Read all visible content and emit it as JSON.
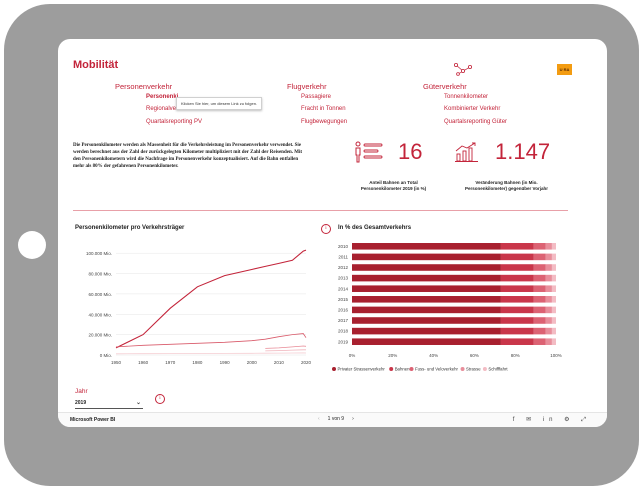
{
  "report": {
    "title": "Mobilität",
    "logo_text": "U RA",
    "nav_sections": [
      {
        "label": "Personenverkehr",
        "items": [
          "Personenki",
          "Regionalve...",
          "Quartalsreporting PV"
        ]
      },
      {
        "label": "Flugverkehr",
        "items": [
          "Passagiere",
          "Fracht in Tonnen",
          "Flugbewegungen"
        ]
      },
      {
        "label": "Güterverkehr",
        "items": [
          "Tonnenkilometer",
          "Kombinierter Verkehr",
          "Quartalsreporting Güter"
        ]
      }
    ],
    "tooltip": "Klicken Sie hier, um diesem Link zu folgen.",
    "description": "Die Personenkilometer werden als Massenheit für die Verkehrsleistung im Personenverkehr verwendet. Sie werden berechnet aus der Zahl der zurückgelegten Kilometer multipliziert mit der Zahl der Reisenden. Mit den Personenkilometern wird die Nachfrage im Personenverkehr konzeptualisiert. Auf die Bahn entfallen mehr als 80% der gefahrenen Personenkilometer.",
    "kpi": [
      {
        "value": "16",
        "label_lines": [
          "Anteil Bahnen an Total",
          "Personenkilometer 2019 (in %)"
        ],
        "icon": "people-bars-icon"
      },
      {
        "value": "1.147",
        "label_lines": [
          "Veränderung Bahnen (in Mio.",
          "Personenkilometer) gegenüber Vorjahr"
        ],
        "icon": "bar-growth-icon"
      }
    ],
    "slicer": {
      "label": "Jahr",
      "value": "2019"
    },
    "footer": {
      "brand": "Microsoft Power BI",
      "page": "1 von 9",
      "prev": "‹",
      "next": "›",
      "share_icons": "f ✉ in ⚙ ⤢"
    }
  },
  "chart_data": [
    {
      "type": "line",
      "title": "Personenkilometer pro Verkehrsträger",
      "x": [
        1950,
        1960,
        1970,
        1980,
        1990,
        2000,
        2005,
        2010,
        2015,
        2019,
        2020
      ],
      "ylim": [
        0,
        110000
      ],
      "yticks": [
        0,
        20000,
        40000,
        60000,
        80000,
        100000
      ],
      "ytick_labels": [
        "0 Mio.",
        "20.000 Mio.",
        "40.000 Mio.",
        "60.000 Mio.",
        "80.000 Mio.",
        "100.000 Mio."
      ],
      "xticks": [
        1950,
        1960,
        1970,
        1980,
        1990,
        2000,
        2010,
        2020
      ],
      "series": [
        {
          "color": "#c3243a",
          "values": [
            7000,
            20000,
            46000,
            67000,
            78000,
            84000,
            87000,
            90000,
            93000,
            102000,
            103000
          ]
        },
        {
          "color": "#d95a6a",
          "values": [
            8000,
            9500,
            10500,
            11500,
            12500,
            14000,
            15500,
            18000,
            20000,
            21000,
            17000
          ]
        },
        {
          "color": "#e88a96",
          "values": [
            null,
            null,
            null,
            null,
            null,
            null,
            6500,
            7000,
            8000,
            8800,
            8500
          ]
        },
        {
          "color": "#f0b3bb",
          "values": [
            null,
            null,
            null,
            null,
            null,
            null,
            4000,
            4300,
            4800,
            5100,
            5100
          ]
        },
        {
          "color": "#f5cdd2",
          "values": [
            1200,
            1300,
            1400,
            1500,
            1600,
            1700,
            1800,
            1900,
            2000,
            2100,
            2000
          ]
        }
      ]
    },
    {
      "type": "bar",
      "title": "In % des Gesamtverkehrs",
      "orientation": "horizontal-stacked-100",
      "categories": [
        "2010",
        "2011",
        "2012",
        "2013",
        "2014",
        "2015",
        "2016",
        "2017",
        "2018",
        "2019"
      ],
      "xtick_labels": [
        "0%",
        "20%",
        "40%",
        "60%",
        "80%",
        "100%"
      ],
      "legend_position": "bottom",
      "series": [
        {
          "name": "Privater Strassenverkehr",
          "color": "#a8202f",
          "values": [
            73,
            73,
            73,
            73,
            73,
            73,
            73,
            73,
            73,
            73
          ]
        },
        {
          "name": "Bahnen",
          "color": "#c9364a",
          "values": [
            16,
            16,
            16,
            16,
            16,
            16,
            16,
            16,
            16,
            16
          ]
        },
        {
          "name": "Fuss- und Veloverkehr",
          "color": "#dc6273",
          "values": [
            6,
            6,
            6,
            6,
            6,
            6,
            6,
            6,
            6,
            6
          ]
        },
        {
          "name": "Strasse",
          "color": "#e88e9b",
          "values": [
            3,
            3,
            3,
            3,
            3,
            3,
            3,
            3,
            3,
            3
          ]
        },
        {
          "name": "Schifffahrt",
          "color": "#f3bcc4",
          "values": [
            2,
            2,
            2,
            2,
            2,
            2,
            2,
            2,
            2,
            2
          ]
        }
      ]
    }
  ]
}
